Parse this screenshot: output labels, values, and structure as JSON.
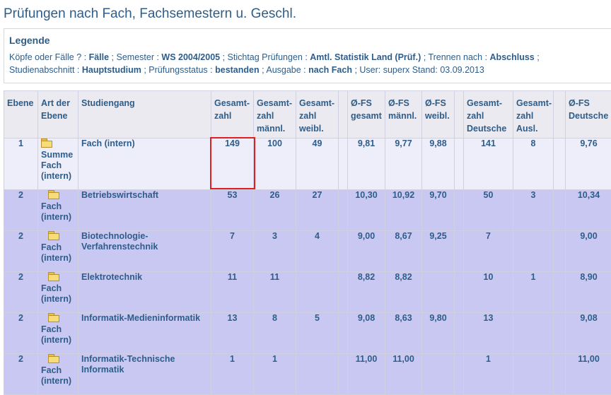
{
  "page": {
    "title": "Prüfungen nach Fach, Fachsemestern u. Geschl."
  },
  "legend": {
    "heading": "Legende",
    "line1": [
      {
        "label": "Köpfe oder Fälle ? :",
        "value": "Fälle"
      },
      {
        "label": "; Semester :",
        "value": "WS 2004/2005"
      },
      {
        "label": "; Stichtag Prüfungen :",
        "value": "Amtl. Statistik Land (Prüf.)"
      },
      {
        "label": "; Trennen nach :",
        "value": "Abschluss"
      },
      {
        "label": ";",
        "value": ""
      }
    ],
    "line2": [
      {
        "label": "Studienabschnitt :",
        "value": "Hauptstudium"
      },
      {
        "label": "; Prüfungsstatus :",
        "value": "bestanden"
      },
      {
        "label": "; Ausgabe :",
        "value": "nach Fach"
      },
      {
        "label": "; User: superx   Stand: 03.09.2013",
        "value": ""
      }
    ]
  },
  "table": {
    "headers": [
      "Ebene",
      "Art der Ebene",
      "Studiengang",
      "Gesamt-zahl",
      "Gesamt-zahl männl.",
      "Gesamt-zahl weibl.",
      "",
      "Ø-FS gesamt",
      "Ø-FS männl.",
      "Ø-FS weibl.",
      "",
      "Gesamt-zahl Deutsche",
      "Gesamt-zahl Ausl.",
      "",
      "Ø-FS Deutsche"
    ],
    "rows": [
      {
        "type": "sum",
        "ebene": "1",
        "art": "Summe Fach (intern)",
        "studiengang": "Fach (intern)",
        "cells": [
          "149",
          "100",
          "49",
          "",
          "9,81",
          "9,77",
          "9,88",
          "",
          "141",
          "8",
          "",
          "9,76"
        ]
      },
      {
        "type": "fach",
        "ebene": "2",
        "art": "Fach (intern)",
        "studiengang": "Betriebswirtschaft",
        "cells": [
          "53",
          "26",
          "27",
          "",
          "10,30",
          "10,92",
          "9,70",
          "",
          "50",
          "3",
          "",
          "10,34"
        ]
      },
      {
        "type": "fach",
        "ebene": "2",
        "art": "Fach (intern)",
        "studiengang": "Biotechnologie-Verfahrenstechnik",
        "cells": [
          "7",
          "3",
          "4",
          "",
          "9,00",
          "8,67",
          "9,25",
          "",
          "7",
          "",
          "",
          "9,00"
        ]
      },
      {
        "type": "fach",
        "ebene": "2",
        "art": "Fach (intern)",
        "studiengang": "Elektrotechnik",
        "cells": [
          "11",
          "11",
          "",
          "",
          "8,82",
          "8,82",
          "",
          "",
          "10",
          "1",
          "",
          "8,90"
        ]
      },
      {
        "type": "fach",
        "ebene": "2",
        "art": "Fach (intern)",
        "studiengang": "Informatik-Medieninformatik",
        "cells": [
          "13",
          "8",
          "5",
          "",
          "9,08",
          "8,63",
          "9,80",
          "",
          "13",
          "",
          "",
          "9,08"
        ]
      },
      {
        "type": "fach",
        "ebene": "2",
        "art": "Fach (intern)",
        "studiengang": "Informatik-Technische Informatik",
        "cells": [
          "1",
          "1",
          "",
          "",
          "11,00",
          "11,00",
          "",
          "",
          "1",
          "",
          "",
          "11,00"
        ]
      }
    ]
  },
  "icons": {
    "folder": "folder-icon",
    "folder_open": "folder-open-icon"
  },
  "colors": {
    "title": "#2e5d8a",
    "sum_row": "#eeeefa",
    "fach_row": "#c8c8f2",
    "highlight": "#e02020"
  }
}
